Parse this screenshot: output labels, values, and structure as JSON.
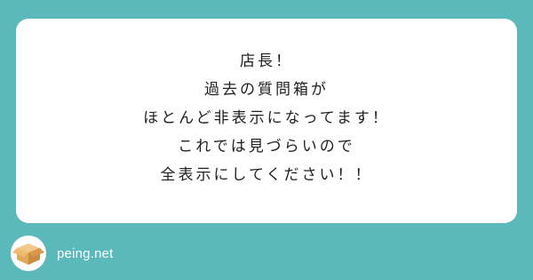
{
  "question": {
    "lines": [
      "店長！",
      "過去の質問箱が",
      "ほとんど非表示になってます！",
      "これでは見づらいので",
      "全表示にしてください！！"
    ]
  },
  "footer": {
    "site": "peing.net",
    "logo_icon": "box-icon"
  },
  "colors": {
    "background": "#5bb8bb",
    "card": "#ffffff",
    "text": "#1f1f1f"
  }
}
